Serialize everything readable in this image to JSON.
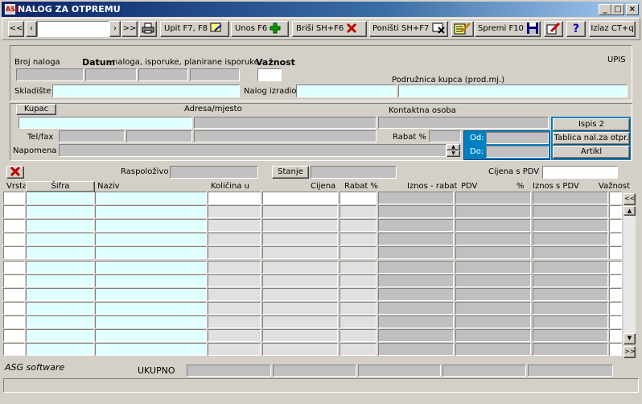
{
  "window": {
    "title": "NALOG ZA OTPREMU",
    "app_icon": "ASG"
  },
  "toolbar": {
    "first": "<<",
    "prev": "‹",
    "next": "›",
    "last": ">>",
    "upit": "Upit F7, F8",
    "unos": "Unos F6",
    "brisi": "Briši  SH+F6",
    "ponisti": "Poništi SH+F7",
    "spremi": "Spremi F10",
    "help": "?",
    "izlaz": "Izlaz CT+q"
  },
  "header": {
    "broj_naloga": "Broj naloga",
    "datum": "Datum",
    "datum_sub": "naloga, isporuke, planirane isporuke",
    "vaznost": "Važnost",
    "upis": "UPIS",
    "podruznica": "Podružnica kupca (prod.mj.)",
    "skladiste": "Skladište",
    "nalog_izradio": "Nalog izradio"
  },
  "customer": {
    "kupac": "Kupac",
    "adresa": "Adresa/mjesto",
    "kontakt": "Kontaktna osoba",
    "telfax": "Tel/fax",
    "rabat": "Rabat %",
    "napomena": "Napomena",
    "od": "Od:",
    "do": "Do:",
    "ispis": "Ispis 2",
    "tablica": "Tablica nal.za otpr.",
    "artikl": "Artikl"
  },
  "detail": {
    "raspolozivo": "Raspoloživo",
    "stanje": "Stanje",
    "cijena_pdv": "Cijena s PDV",
    "columns": [
      "Vrsta",
      "Šifra",
      "Naziv",
      "Količina u",
      "Cijena",
      "Rabat %",
      "Iznos - rabat",
      "PDV",
      "%",
      "Iznos s PDV",
      "Važnost"
    ],
    "scroll_up": "<<",
    "scroll_down": ">>"
  },
  "footer": {
    "brand": "ASG software",
    "ukupno": "UKUPNO"
  },
  "colors": {
    "title_start": "#0a246a",
    "title_end": "#a6caf0",
    "cyan": "#e0ffff",
    "accent_blue": "#0080c0"
  }
}
